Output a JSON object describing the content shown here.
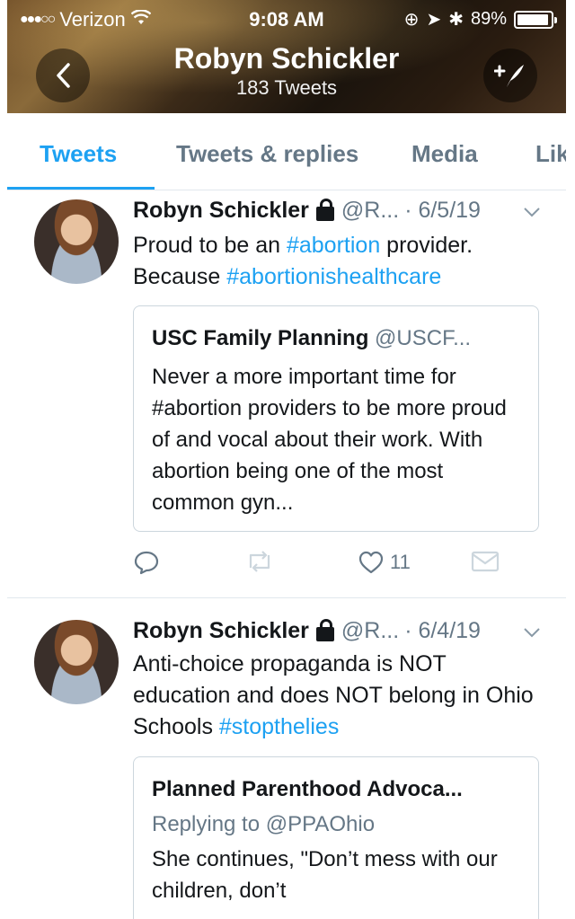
{
  "status_bar": {
    "carrier": "Verizon",
    "time": "9:08 AM",
    "battery": "89%"
  },
  "header": {
    "title": "Robyn Schickler",
    "subtitle": "183 Tweets",
    "back_icon": "chevron-left-icon",
    "compose_icon": "compose-icon"
  },
  "tabs": [
    {
      "label": "Tweets",
      "active": true
    },
    {
      "label": "Tweets & replies",
      "active": false
    },
    {
      "label": "Media",
      "active": false
    },
    {
      "label": "Lik",
      "active": false
    }
  ],
  "tweets": [
    {
      "name": "Robyn Schickler",
      "handle": "@R...",
      "date": "· 6/5/19",
      "text_line1_a": "Proud to be an ",
      "text_line1_tag": "#abortion",
      "text_line1_b": " provider.",
      "text_line2_a": "Because ",
      "text_line2_tag": "#abortionishealthcare",
      "quote": {
        "name": "USC Family Planning",
        "handle": "@USCF...",
        "body": "Never a more important time for #abortion providers to be more proud of and vocal about their work. With abortion being one of the most common gyn..."
      },
      "likes": "11"
    },
    {
      "name": "Robyn Schickler",
      "handle": "@R...",
      "date": "· 6/4/19",
      "text_a": "Anti-choice propaganda is NOT education and does NOT belong in Ohio Schools ",
      "text_tag": "#stopthelies",
      "quote": {
        "name": "Planned Parenthood Advoca...",
        "replying": "Replying to @PPAOhio",
        "body": "She continues, \"Don’t mess with our children, don’t"
      }
    }
  ],
  "colors": {
    "accent": "#1da1f2",
    "muted": "#657786",
    "text": "#14171a"
  }
}
